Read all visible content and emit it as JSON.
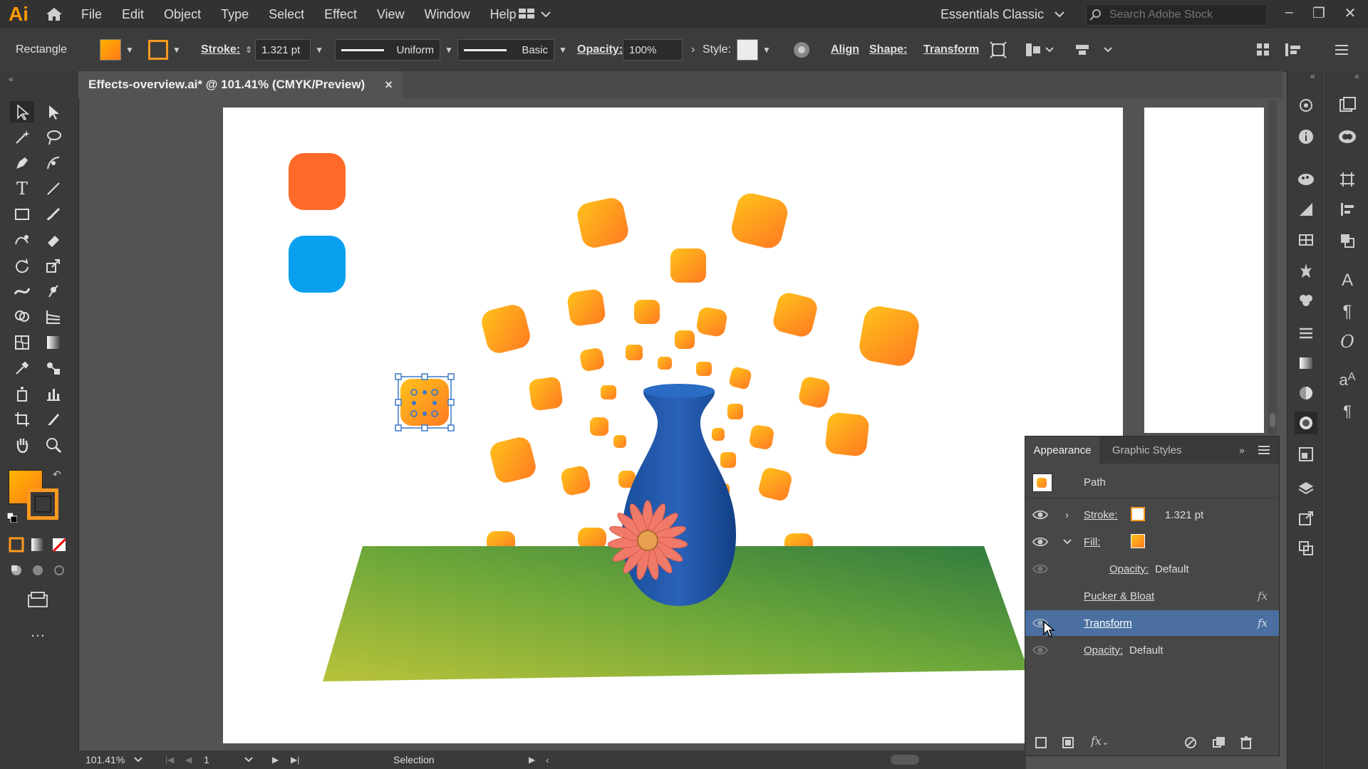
{
  "app": {
    "logo": "Ai"
  },
  "menu": [
    "File",
    "Edit",
    "Object",
    "Type",
    "Select",
    "Effect",
    "View",
    "Window",
    "Help"
  ],
  "workspace": {
    "label": "Essentials Classic"
  },
  "search": {
    "placeholder": "Search Adobe Stock"
  },
  "control": {
    "object_type": "Rectangle",
    "stroke_label": "Stroke:",
    "stroke_value": "1.321 pt",
    "profile_label": "Uniform",
    "brush_label": "Basic",
    "opacity_label": "Opacity:",
    "opacity_value": "100%",
    "style_label": "Style:",
    "align_label": "Align",
    "shape_label": "Shape:",
    "transform_label": "Transform"
  },
  "document": {
    "tab_title": "Effects-overview.ai* @ 101.41% (CMYK/Preview)",
    "close": "×"
  },
  "appearance": {
    "tab_active": "Appearance",
    "tab_other": "Graphic Styles",
    "title": "Path",
    "rows": [
      {
        "label": "Stroke:",
        "value": "1.321 pt"
      },
      {
        "label": "Fill:",
        "value": ""
      },
      {
        "label": "Opacity:",
        "value": "Default"
      },
      {
        "label": "Pucker & Bloat",
        "value": ""
      },
      {
        "label": "Transform",
        "value": ""
      },
      {
        "label": "Opacity:",
        "value": "Default"
      }
    ],
    "fx": "fx"
  },
  "status": {
    "zoom": "101.41%",
    "page": "1",
    "tool": "Selection"
  },
  "colors": {
    "accent_orange": "#ff9a1f",
    "shape_orange": "#ff6a2a",
    "shape_blue": "#0aa0f0",
    "vase_blue": "#1f55a8",
    "table_green": "#4f8a2f",
    "selection_blue": "#3b78c8"
  }
}
